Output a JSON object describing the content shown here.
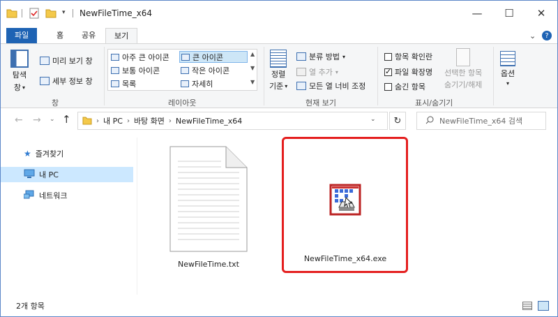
{
  "window": {
    "title": "NewFileTime_x64",
    "controls": {
      "minimize": "—",
      "maximize": "☐",
      "close": "✕"
    }
  },
  "ribbon_tabs": [
    {
      "label": "파일"
    },
    {
      "label": "홈"
    },
    {
      "label": "공유"
    },
    {
      "label": "보기"
    }
  ],
  "ribbon": {
    "pane": {
      "nav_pane_label": "탐색",
      "nav_pane_label2": "창",
      "preview_label": "미리 보기 창",
      "details_label": "세부 정보 창",
      "group_label": "창"
    },
    "layout": {
      "items": [
        "아주 큰 아이콘",
        "큰 아이콘",
        "보통 아이콘",
        "작은 아이콘",
        "목록",
        "자세히"
      ],
      "selected": "큰 아이콘",
      "group_label": "레이아웃"
    },
    "current_view": {
      "sort_label": "정렬",
      "sort_label2": "기준",
      "group_by": "분류 방법",
      "add_column": "열 추가",
      "fit_columns": "모든 열 너비 조정",
      "group_label": "현재 보기"
    },
    "show_hide": {
      "item_checkboxes": "항목 확인란",
      "file_extensions": "파일 확장명",
      "hidden_items": "숨긴 항목",
      "hide_selected": "선택한 항목",
      "hide_selected2": "숨기기/해제",
      "group_label": "표시/숨기기",
      "file_extensions_checked": true
    },
    "options": {
      "label": "옵션"
    }
  },
  "address": {
    "crumbs": [
      "내 PC",
      "바탕 화면",
      "NewFileTime_x64"
    ],
    "search_placeholder": "NewFileTime_x64 검색"
  },
  "nav_pane": [
    {
      "label": "즐겨찾기",
      "icon": "star-icon"
    },
    {
      "label": "내 PC",
      "icon": "computer-icon",
      "selected": true
    },
    {
      "label": "네트워크",
      "icon": "network-icon"
    }
  ],
  "files": [
    {
      "name": "NewFileTime.txt",
      "type": "text-document-icon"
    },
    {
      "name": "NewFileTime_x64.exe",
      "type": "app-icon",
      "highlighted": true
    }
  ],
  "status": {
    "item_count": "2개 항목"
  },
  "colors": {
    "accent": "#1e63b4",
    "highlight": "#e41e1e",
    "selection": "#cce8ff"
  }
}
